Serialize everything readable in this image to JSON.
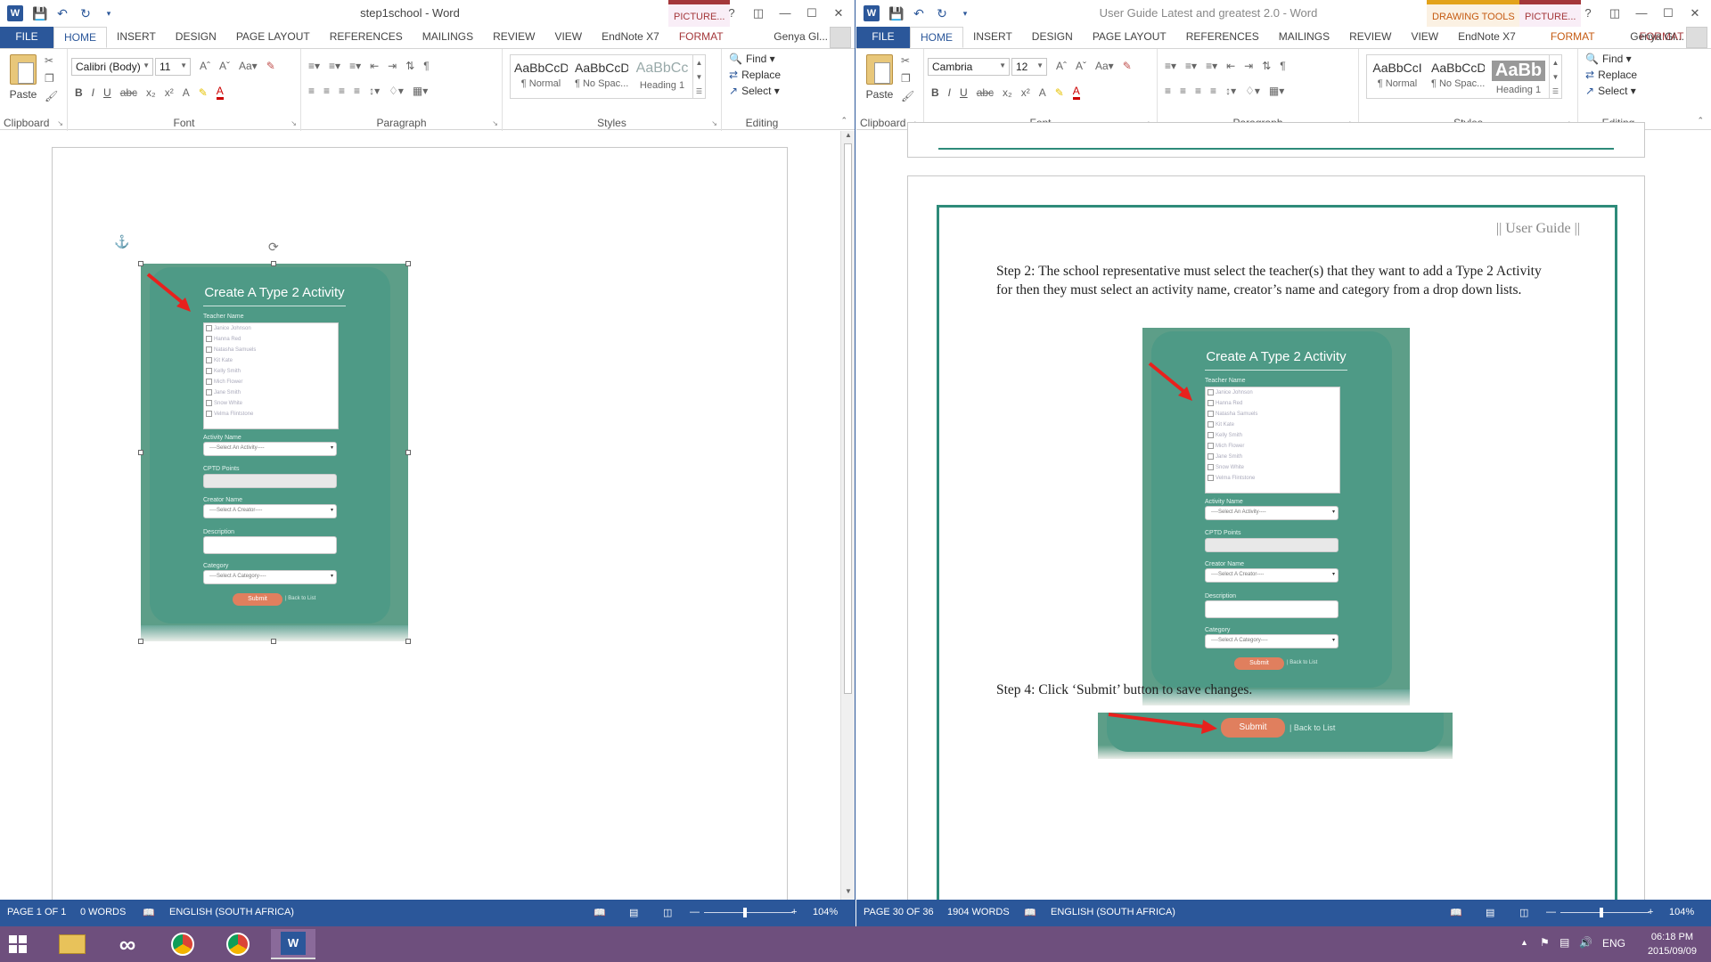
{
  "left_window": {
    "title": "step1school - Word",
    "context_tab_header": "PICTURE...",
    "tabs": [
      "FILE",
      "HOME",
      "INSERT",
      "DESIGN",
      "PAGE LAYOUT",
      "REFERENCES",
      "MAILINGS",
      "REVIEW",
      "VIEW",
      "EndNote X7",
      "FORMAT"
    ],
    "user": "Genya Gl...",
    "font_name": "Calibri (Body)",
    "font_size": "11",
    "styles": [
      {
        "preview": "AaBbCcDc",
        "name": "¶ Normal"
      },
      {
        "preview": "AaBbCcDc",
        "name": "¶ No Spac..."
      },
      {
        "preview": "AaBbCc",
        "name": "Heading 1"
      }
    ],
    "group_labels": {
      "clipboard": "Clipboard",
      "font": "Font",
      "paragraph": "Paragraph",
      "styles": "Styles",
      "editing": "Editing"
    },
    "paste_label": "Paste",
    "editing": {
      "find": "Find",
      "replace": "Replace",
      "select": "Select"
    },
    "status": {
      "page": "PAGE 1 OF 1",
      "words": "0 WORDS",
      "language": "ENGLISH (SOUTH AFRICA)",
      "zoom": "104%"
    }
  },
  "right_window": {
    "title": "User Guide Latest and greatest 2.0 - Word",
    "context_tab_headers": [
      "DRAWING TOOLS",
      "PICTURE..."
    ],
    "tabs": [
      "FILE",
      "HOME",
      "INSERT",
      "DESIGN",
      "PAGE LAYOUT",
      "REFERENCES",
      "MAILINGS",
      "REVIEW",
      "VIEW",
      "EndNote X7",
      "FORMAT",
      "FORMAT"
    ],
    "user": "Genya Gl...",
    "font_name": "Cambria",
    "font_size": "12",
    "styles": [
      {
        "preview": "AaBbCcI",
        "name": "¶ Normal"
      },
      {
        "preview": "AaBbCcDc",
        "name": "¶ No Spac..."
      },
      {
        "preview": "AaBb",
        "name": "Heading 1"
      }
    ],
    "group_labels": {
      "clipboard": "Clipboard",
      "font": "Font",
      "paragraph": "Paragraph",
      "styles": "Styles",
      "editing": "Editing"
    },
    "paste_label": "Paste",
    "editing": {
      "find": "Find",
      "replace": "Replace",
      "select": "Select"
    },
    "header_text": "|| User Guide ||",
    "step2_text": "Step 2: The school representative must select the teacher(s) that they want to add a Type 2 Activity for then they must select an activity name, creator’s name and category from a drop down lists.",
    "step4_text": "Step 4: Click ‘Submit’ button to save changes.",
    "status": {
      "page": "PAGE 30 OF 36",
      "words": "1904 WORDS",
      "language": "ENGLISH (SOUTH AFRICA)",
      "zoom": "104%"
    }
  },
  "form": {
    "title": "Create A Type 2 Activity",
    "teacher_label": "Teacher Name",
    "teachers": [
      "Janice Johnson",
      "Hanna Red",
      "Natasha Samuels",
      "Kit Kate",
      "Kelly Smith",
      "Mich Flower",
      "Jane Smith",
      "Snow White",
      "Velma Flintstone"
    ],
    "activity_label": "Activity Name",
    "activity_placeholder": "----Select An Activity----",
    "cptd_label": "CPTD Points",
    "creator_label": "Creator Name",
    "creator_placeholder": "----Select A Creator----",
    "description_label": "Description",
    "category_label": "Category",
    "category_placeholder": "----Select A Category----",
    "submit": "Submit",
    "back": "| Back to List"
  },
  "taskbar": {
    "language": "ENG",
    "time": "06:18 PM",
    "date": "2015/09/09"
  },
  "colors": {
    "word_blue": "#2b579a",
    "form_green": "#4e9a86",
    "submit_orange": "#e07f5e",
    "page_border": "#2e8b7a",
    "taskbar": "#6e4f7d"
  }
}
